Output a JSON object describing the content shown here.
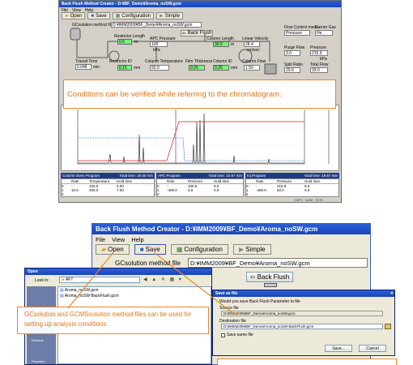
{
  "top_window": {
    "title": "Back Flush Method Creator - D:¥BF_Demo¥Aroma_noSW.gcm",
    "menu": [
      "File",
      "View",
      "Help"
    ],
    "toolbar": {
      "open": "Open",
      "save": "Save",
      "configuration": "Configuration",
      "simple": "Simple"
    },
    "method_label": "GCsolution method file",
    "method_path": "D:¥IMM2009¥BF_Demo¥Aroma_noSW.gcm",
    "back_flush_button": "Back Flush",
    "fields": {
      "restrictor_length_label": "Restrictor Length",
      "restrictor_length": "0.5",
      "restrictor_length_unit": "m",
      "apc_pressure_label": "APC Pressure",
      "apc_pressure": "100",
      "apc_pressure_unit": "kPa",
      "column_length_label": "Column Length",
      "column_length": "30.0",
      "column_length_unit": "m",
      "linear_velocity_label": "Linear Velocity",
      "linear_velocity": "28.4",
      "linear_velocity_unit": "cm/sec",
      "flow_control_mode_label": "Flow Control mode",
      "flow_control_mode": "Pressure",
      "carrier_gas_label": "Carrier Gas",
      "carrier_gas": "He",
      "transit_time_label": "Transit Time",
      "transit_time": "0.048",
      "transit_time_unit": "min",
      "restrictor_id_label": "Restrictor ID",
      "restrictor_id": "0.15",
      "restrictor_id_unit": "mm",
      "column_temperature_label": "Column Temperature",
      "column_temperature": "50.0",
      "film_thickness_label": "Film Thickness",
      "film_thickness": "0.25",
      "column_id_label": "Column ID",
      "column_id": "0.25",
      "column_id_unit": "mm",
      "purge_flow_label": "Purge Flow",
      "purge_flow": "3.0",
      "pressure_label": "Pressure",
      "pressure": "215.9",
      "pressure_unit": "kPa",
      "column_flow_label": "Column Flow",
      "column_flow": "1.50",
      "split_ratio_label": "Split Ratio",
      "split_ratio": "20.0",
      "total_flow_label": "Total Flow",
      "total_flow": "33.0"
    },
    "callout": "Conditions can be verified while referring to the chromatogram.",
    "tables": {
      "oven_title": "Column Oven Program",
      "oven_total": "Total time: 20.00 min",
      "oven_headers": [
        "",
        "Rate",
        "Temperature",
        "Hold time"
      ],
      "oven_rows": [
        [
          "0",
          "-",
          "100.0",
          "0.00"
        ],
        [
          "1",
          "10.0",
          "200.0",
          "7.00"
        ],
        [
          "2",
          "",
          "",
          ""
        ]
      ],
      "apc_title": "APC Program",
      "apc_total": "Total time: 10.67 min",
      "apc_headers": [
        "",
        "Rate",
        "Pressure",
        "Hold time"
      ],
      "apc_rows": [
        [
          "0",
          "-",
          "100.0",
          "9.0"
        ],
        [
          "1",
          "-400.0",
          "0.0",
          "0.0"
        ],
        [
          "2",
          "",
          "",
          ""
        ]
      ],
      "inj_title": "Inj.Program",
      "inj_total": "Total time: 19.67 min",
      "inj_headers": [
        "",
        "Rate",
        "Pressure",
        "Hold time"
      ],
      "inj_rows": [
        [
          "0",
          "-",
          "215.9",
          "9.0"
        ],
        [
          "1",
          "-400.0",
          "50.0",
          "0.0"
        ],
        [
          "2",
          "",
          "",
          ""
        ]
      ]
    },
    "status": [
      "CAPS",
      "NUM",
      "SCRL"
    ]
  },
  "bottom_window": {
    "title": "Back Flush Method Creator - D:¥IMM2009¥BF_Demo¥Aroma_noSW.gcm",
    "menu": [
      "File",
      "View",
      "Help"
    ],
    "toolbar": {
      "open": "Open",
      "save": "Save",
      "configuration": "Configuration",
      "simple": "Simple"
    },
    "method_label": "GCsolution method file",
    "method_path": "D:¥IMM2009¥BF_Demo¥Aroma_noSW.gcm",
    "back_flush_button": "Back Flush"
  },
  "open_dialog": {
    "title": "Open",
    "look_in_label": "Look in:",
    "look_in_value": "AFT",
    "files": [
      "Aroma_noSW.gcm",
      "Aroma_noSW-BackFlush.gcm"
    ],
    "places": [
      "History",
      "Desktop",
      "Favorites"
    ]
  },
  "save_dialog": {
    "title": "Save as file",
    "question": "Would you save Back Flush Parameter to file",
    "source_label": "Source file",
    "source_value": "D:¥IMM2009¥BF_Demo¥Aroma_noSW.gcm",
    "dest_label": "Destination file",
    "dest_value": "D:¥IMM2009¥BF_Demo¥Aroma_noSW-BackFlush.gcm",
    "same_file_label": "Save same file",
    "save_button": "Save...",
    "cancel_button": "Cancel"
  },
  "bottom_callout": "GCsolution and GCMSsolution method files can be used for setting up analysis conditions.",
  "colors": {
    "accent_orange": "#e8862a",
    "xp_blue": "#2a5fd8",
    "field_green": "#7cf27c"
  }
}
